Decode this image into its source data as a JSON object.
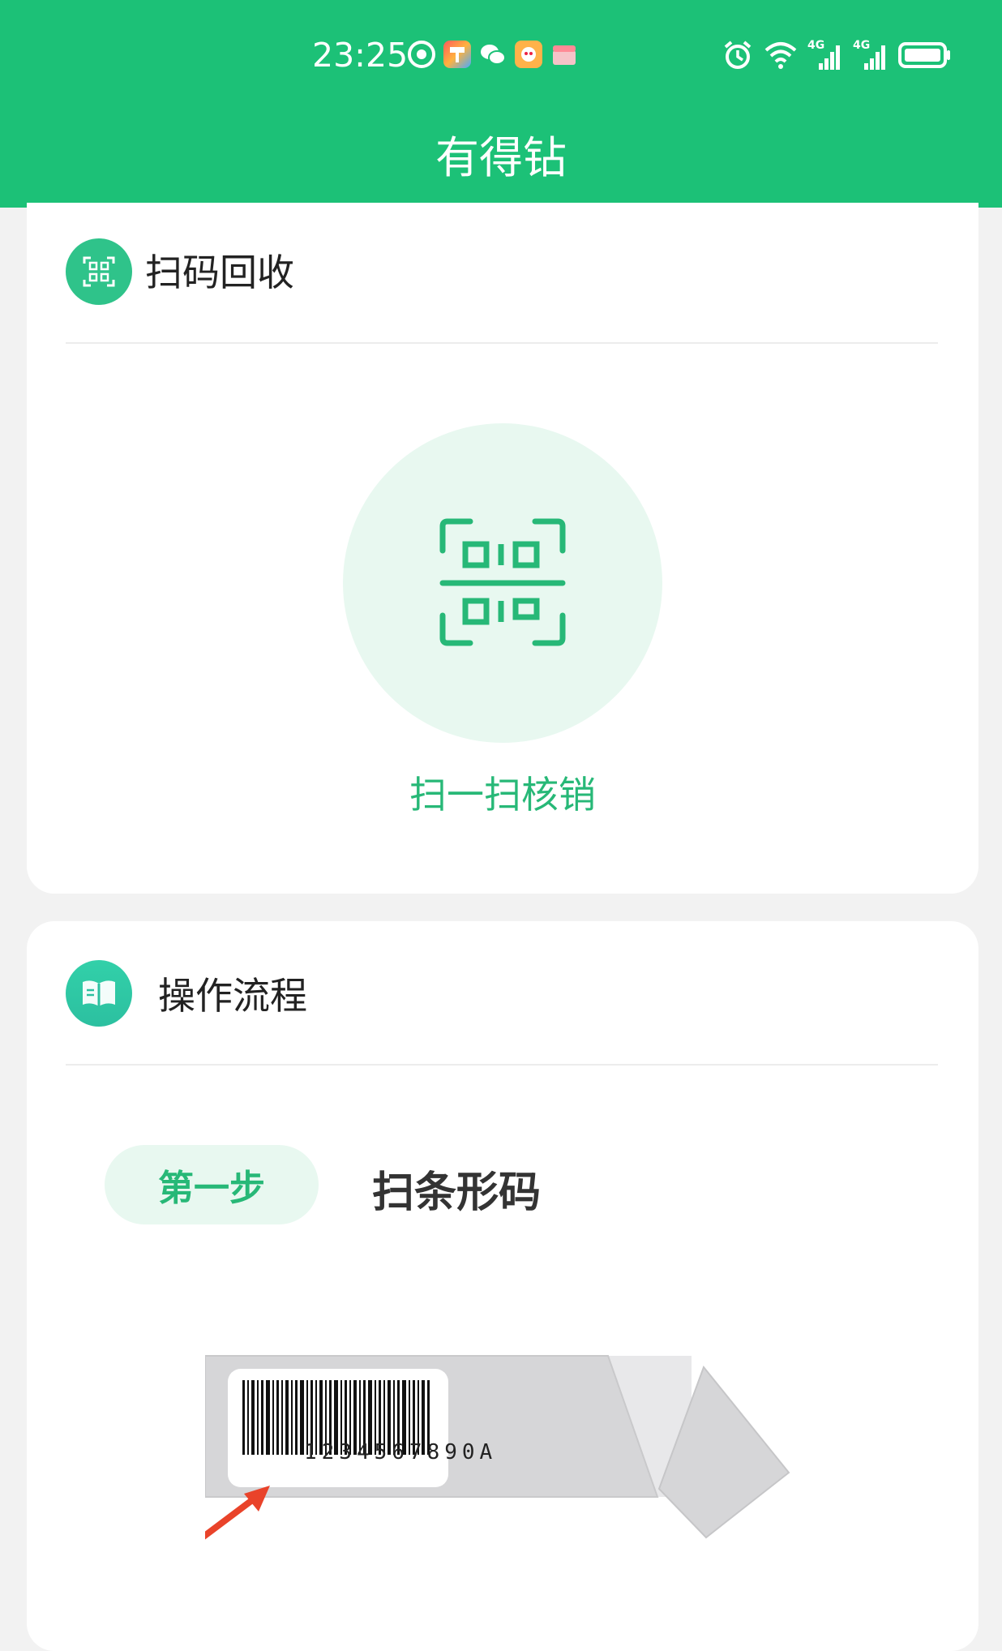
{
  "status_bar": {
    "time": "23:25",
    "app_icons": [
      "qq-browser-icon",
      "paint-app-icon",
      "wechat-icon",
      "618-promo-icon",
      "gift-box-icon"
    ],
    "right_icons": [
      "alarm-icon",
      "wifi-icon",
      "signal-4g-icon",
      "signal-4g-icon",
      "battery-icon"
    ],
    "net_label_1": "4G",
    "net_label_2": "4G"
  },
  "nav": {
    "title": "有得钻"
  },
  "scan_card": {
    "title": "扫码回收",
    "icon": "qr-scan-icon",
    "action_icon": "qr-scan-icon",
    "action_label": "扫一扫核销"
  },
  "process_card": {
    "title": "操作流程",
    "icon": "book-icon",
    "step_badge": "第一步",
    "step_text": "扫条形码",
    "barcode_number": "1234567890A",
    "illustration_icon": "barcode-label-illustration"
  },
  "colors": {
    "header": "#1cc177",
    "accent": "#27b877",
    "accent_light": "#e8f8f0",
    "background": "#f2f2f2"
  }
}
